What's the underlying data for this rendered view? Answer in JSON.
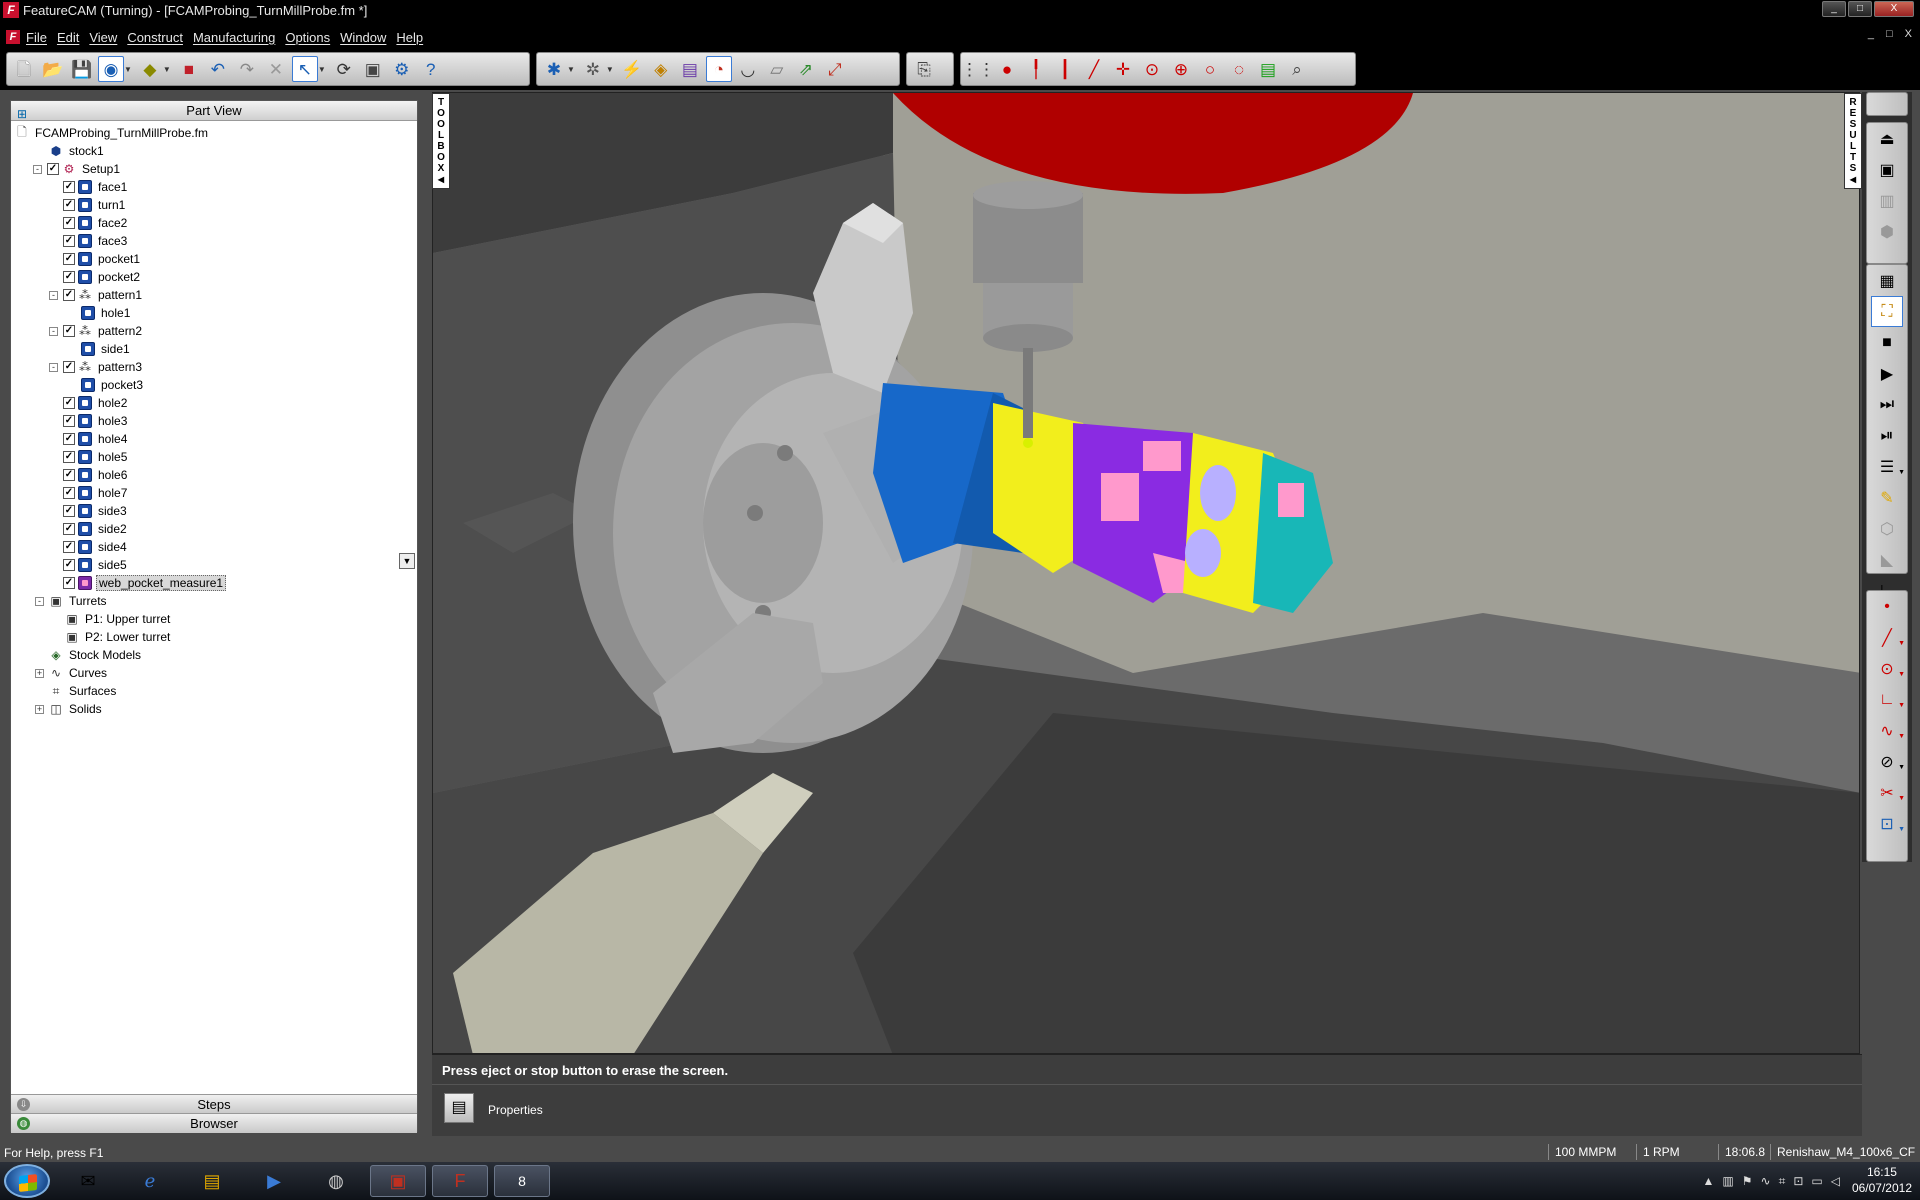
{
  "window": {
    "title": "FeatureCAM (Turning) - [FCAMProbing_TurnMillProbe.fm *]",
    "logo_letter": "F",
    "controls": [
      "_",
      "□",
      "X"
    ]
  },
  "menu": {
    "items": [
      "File",
      "Edit",
      "View",
      "Construct",
      "Manufacturing",
      "Options",
      "Window",
      "Help"
    ],
    "mdi_controls": [
      "_",
      "□",
      "X"
    ]
  },
  "left_panel": {
    "header": "Part View",
    "tree": [
      {
        "label": "FCAMProbing_TurnMillProbe.fm",
        "level": 0,
        "icon": "document-icon"
      },
      {
        "label": "stock1",
        "level": 1,
        "icon": "stock-icon"
      },
      {
        "label": "Setup1",
        "level": 1,
        "icon": "setup-icon",
        "expander": "-",
        "checked": true
      },
      {
        "label": "face1",
        "level": 2,
        "icon": "feature-icon",
        "checked": true
      },
      {
        "label": "turn1",
        "level": 2,
        "icon": "feature-icon",
        "checked": true
      },
      {
        "label": "face2",
        "level": 2,
        "icon": "feature-icon",
        "checked": true
      },
      {
        "label": "face3",
        "level": 2,
        "icon": "feature-icon",
        "checked": true
      },
      {
        "label": "pocket1",
        "level": 2,
        "icon": "feature-icon",
        "checked": true
      },
      {
        "label": "pocket2",
        "level": 2,
        "icon": "feature-icon",
        "checked": true
      },
      {
        "label": "pattern1",
        "level": 2,
        "icon": "pattern-icon",
        "expander": "-",
        "checked": true
      },
      {
        "label": "hole1",
        "level": 3,
        "icon": "feature-icon"
      },
      {
        "label": "pattern2",
        "level": 2,
        "icon": "pattern-icon",
        "expander": "-",
        "checked": true
      },
      {
        "label": "side1",
        "level": 3,
        "icon": "feature-icon"
      },
      {
        "label": "pattern3",
        "level": 2,
        "icon": "pattern-icon",
        "expander": "-",
        "checked": true
      },
      {
        "label": "pocket3",
        "level": 3,
        "icon": "feature-icon"
      },
      {
        "label": "hole2",
        "level": 2,
        "icon": "feature-icon",
        "checked": true
      },
      {
        "label": "hole3",
        "level": 2,
        "icon": "feature-icon",
        "checked": true
      },
      {
        "label": "hole4",
        "level": 2,
        "icon": "feature-icon",
        "checked": true
      },
      {
        "label": "hole5",
        "level": 2,
        "icon": "feature-icon",
        "checked": true
      },
      {
        "label": "hole6",
        "level": 2,
        "icon": "feature-icon",
        "checked": true
      },
      {
        "label": "hole7",
        "level": 2,
        "icon": "feature-icon",
        "checked": true
      },
      {
        "label": "side3",
        "level": 2,
        "icon": "feature-icon",
        "checked": true
      },
      {
        "label": "side2",
        "level": 2,
        "icon": "feature-icon",
        "checked": true
      },
      {
        "label": "side4",
        "level": 2,
        "icon": "feature-icon",
        "checked": true
      },
      {
        "label": "side5",
        "level": 2,
        "icon": "feature-icon",
        "checked": true
      },
      {
        "label": "web_pocket_measure1",
        "level": 2,
        "icon": "measure-icon",
        "checked": true,
        "selected": true
      },
      {
        "label": "Turrets",
        "level": 1,
        "icon": "turret-icon",
        "expander": "-"
      },
      {
        "label": "P1: Upper turret",
        "level": 2,
        "icon": "turret-icon"
      },
      {
        "label": "P2: Lower turret",
        "level": 2,
        "icon": "turret-icon"
      },
      {
        "label": "Stock Models",
        "level": 1,
        "icon": "stock-model-icon"
      },
      {
        "label": "Curves",
        "level": 1,
        "icon": "curve-icon",
        "expander": "+"
      },
      {
        "label": "Surfaces",
        "level": 1,
        "icon": "surface-icon"
      },
      {
        "label": "Solids",
        "level": 1,
        "icon": "solid-icon",
        "expander": "+"
      }
    ],
    "tabs": {
      "steps": "Steps",
      "browser": "Browser"
    }
  },
  "viewport": {
    "toolbox_label": "TOOLBOX",
    "results_label": "RESULTS",
    "colors": {
      "background": "#6b6b6b",
      "wall": "#a09f96",
      "spindle": "#b00000",
      "blue_band": "#1768c9",
      "yellow": "#f2ee1c",
      "purple": "#8a2be2",
      "teal": "#18b7b7"
    }
  },
  "message": "Press eject or stop button to erase the screen.",
  "properties_label": "Properties",
  "status": {
    "help": "For Help, press F1",
    "feed": "100 MMPM",
    "speed": "1 RPM",
    "time": "18:06.8",
    "tool": "Renishaw_M4_100x6_CF"
  },
  "taskbar": {
    "clock_time": "16:15",
    "clock_date": "06/07/2012",
    "psp_badge": "8"
  }
}
